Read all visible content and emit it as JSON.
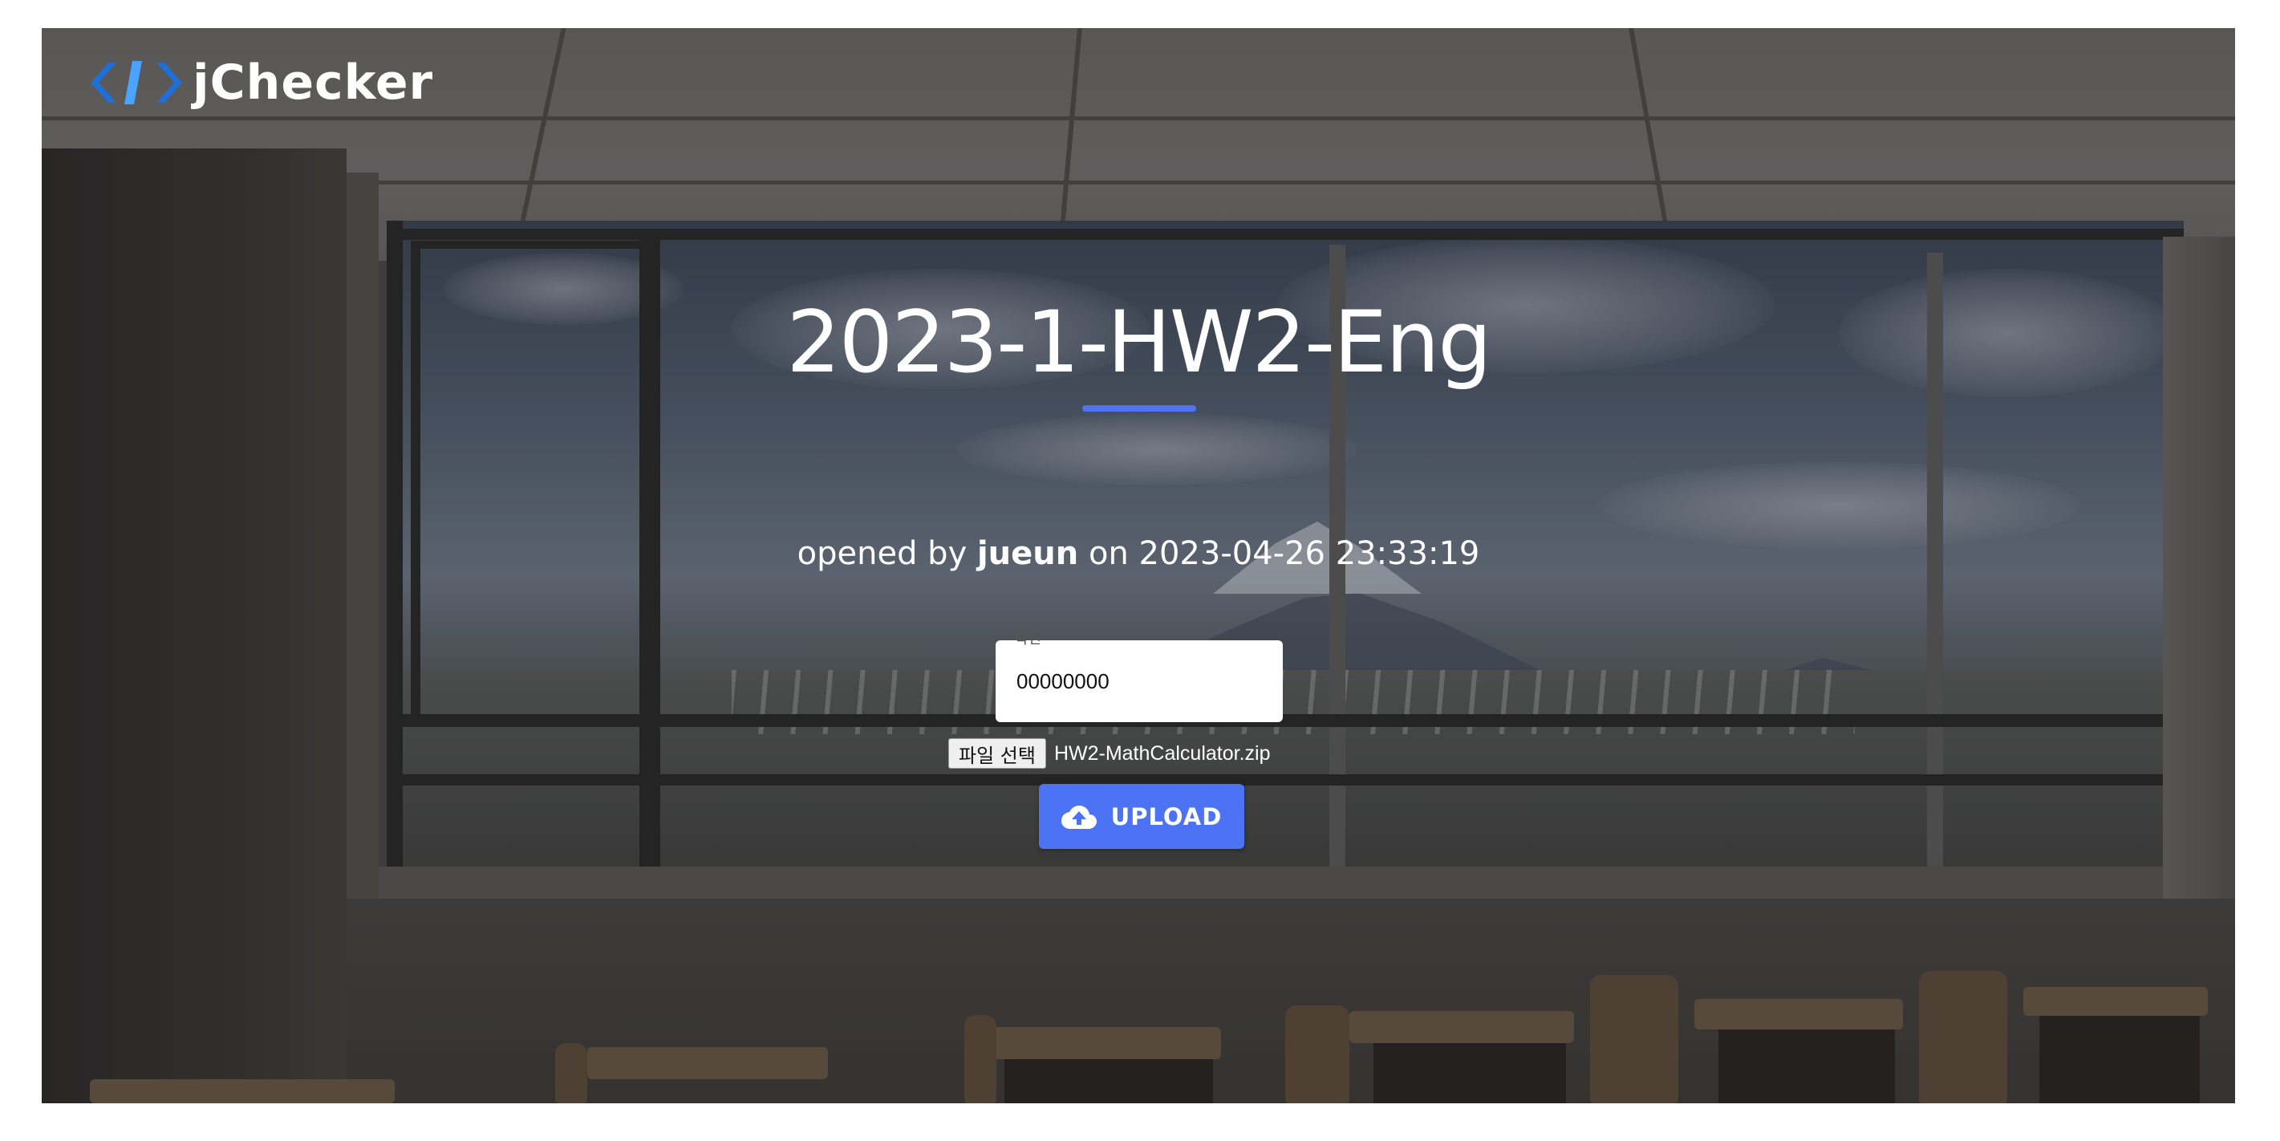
{
  "brand": {
    "name": "jChecker",
    "logo_icon": "code-brackets-icon",
    "logo_colors": [
      "#1f6fd6",
      "#4aa3ff"
    ]
  },
  "hero": {
    "title": "2023-1-HW2-Eng",
    "accent_color": "#4f73f2",
    "opened_by_prefix": "opened by",
    "author": "jueun",
    "on_word": "on",
    "opened_at": "2023-04-26 23:33:19"
  },
  "form": {
    "student_id_label": "학번",
    "student_id_value": "00000000",
    "file_button_label": "파일 선택",
    "file_name": "HW2-MathCalculator.zip",
    "upload_label": "UPLOAD",
    "upload_icon": "cloud-upload-icon",
    "upload_color": "#4d73f5"
  }
}
